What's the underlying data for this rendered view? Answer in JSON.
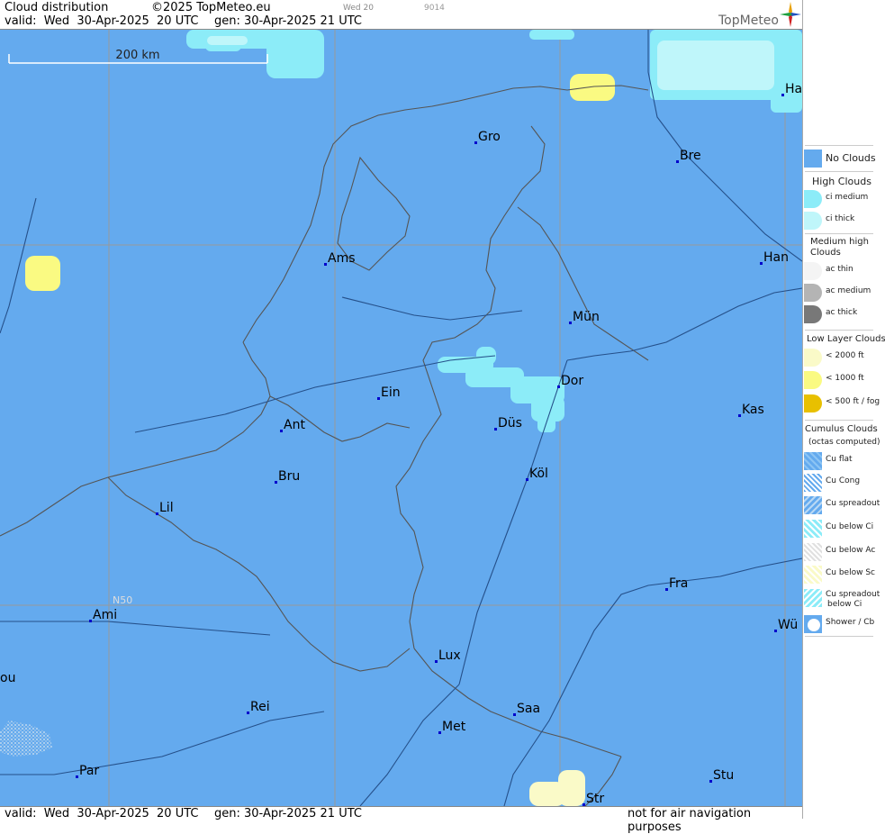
{
  "header": {
    "title": "Cloud distribution",
    "copyright": "©2025 TopMeteo.eu",
    "day_code": "Wed 20",
    "id_code": "9014",
    "valid": "valid:  Wed  30-Apr-2025  20 UTC",
    "gen": "gen: 30-Apr-2025 21 UTC",
    "logo": "TopMeteo"
  },
  "footer": {
    "valid": "valid:  Wed  30-Apr-2025  20 UTC",
    "gen": "gen: 30-Apr-2025 21 UTC",
    "note": "not for air navigation purposes"
  },
  "map": {
    "scale_label": "200 km",
    "lat_label": "N50",
    "colors": {
      "sea_land": "#64aaee",
      "ci_medium": "#8cecf8",
      "ci_thick": "#bff6fa",
      "low_2000": "#fafac8",
      "low_1000": "#fafa82",
      "fog": "#e8c000",
      "border": "#666666",
      "river": "#254f88",
      "grid": "#999999"
    },
    "cities": [
      {
        "name": "Gro"
      },
      {
        "name": "Bre"
      },
      {
        "name": "Ha"
      },
      {
        "name": "Ams"
      },
      {
        "name": "Han"
      },
      {
        "name": "Mün"
      },
      {
        "name": "Dor"
      },
      {
        "name": "Ein"
      },
      {
        "name": "Ant"
      },
      {
        "name": "Düs"
      },
      {
        "name": "Kas"
      },
      {
        "name": "Bru"
      },
      {
        "name": "Köl"
      },
      {
        "name": "Lil"
      },
      {
        "name": "Fra"
      },
      {
        "name": "Ami"
      },
      {
        "name": "Wü"
      },
      {
        "name": "Lux"
      },
      {
        "name": "ou"
      },
      {
        "name": "Rei"
      },
      {
        "name": "Saa"
      },
      {
        "name": "Met"
      },
      {
        "name": "Par"
      },
      {
        "name": "Stu"
      },
      {
        "name": "Str"
      }
    ]
  },
  "legend": {
    "no_clouds": "No Clouds",
    "high_head": "High Clouds",
    "ci_medium": "ci medium",
    "ci_thick": "ci thick",
    "medium_head": "Medium high Clouds",
    "ac_thin": "ac thin",
    "ac_medium": "ac medium",
    "ac_thick": "ac thick",
    "low_head": "Low Layer Clouds",
    "low_2000": "< 2000 ft",
    "low_1000": "< 1000 ft",
    "low_500": "< 500 ft / fog",
    "cu_head": "Cumulus Clouds",
    "cu_sub": "(octas computed)",
    "cu_flat": "Cu flat",
    "cu_cong": "Cu Cong",
    "cu_spread": "Cu spreadout",
    "cu_below_ci": "Cu below Ci",
    "cu_below_ac": "Cu below Ac",
    "cu_below_sc": "Cu below Sc",
    "cu_spread_ci_1": "Cu spreadout",
    "cu_spread_ci_2": "below Ci",
    "shower": "Shower / Cb"
  }
}
